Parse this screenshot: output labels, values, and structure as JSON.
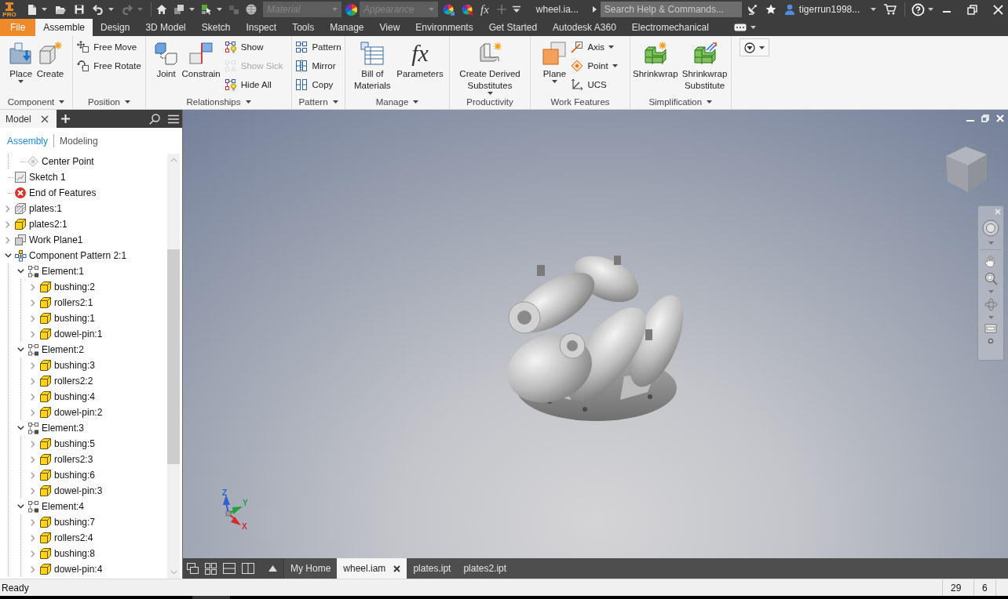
{
  "title_bar": {
    "logo_badge": "PRO",
    "quick_access": [
      {
        "dropdown": true,
        "disabled": false
      },
      {
        "dropdown": false,
        "disabled": false
      },
      {
        "dropdown": false,
        "disabled": false
      },
      {
        "dropdown": true,
        "disabled": false
      },
      {
        "dropdown": true,
        "disabled": true
      }
    ],
    "view_tools": [
      {
        "dropdown": false,
        "disabled": false
      },
      {
        "dropdown": true,
        "disabled": false
      },
      {
        "dropdown": true,
        "disabled": false
      },
      {
        "dropdown": false,
        "disabled": true
      },
      {
        "dropdown": false,
        "disabled": false
      }
    ],
    "material": {
      "placeholder": "Material",
      "disabled": true
    },
    "appearance": {
      "placeholder": "Appearance",
      "disabled": true
    },
    "formula_symbol": "fx",
    "document_name": "wheel.ia...",
    "search": {
      "placeholder": "Search Help & Commands..."
    },
    "user": "tigerrun1998..."
  },
  "ribbon_tabs": [
    {
      "label": "File",
      "kind": "application",
      "selected": false
    },
    {
      "label": "Assemble",
      "kind": "tab",
      "selected": true
    },
    {
      "label": "Design",
      "kind": "tab",
      "selected": false
    },
    {
      "label": "3D Model",
      "kind": "tab",
      "selected": false
    },
    {
      "label": "Sketch",
      "kind": "tab",
      "selected": false
    },
    {
      "label": "Inspect",
      "kind": "tab",
      "selected": false
    },
    {
      "label": "Tools",
      "kind": "tab",
      "selected": false
    },
    {
      "label": "Manage",
      "kind": "tab",
      "selected": false
    },
    {
      "label": "View",
      "kind": "tab",
      "selected": false
    },
    {
      "label": "Environments",
      "kind": "tab",
      "selected": false
    },
    {
      "label": "Get Started",
      "kind": "tab",
      "selected": false
    },
    {
      "label": "Autodesk A360",
      "kind": "tab",
      "selected": false
    },
    {
      "label": "Electromechanical",
      "kind": "tab",
      "selected": false
    }
  ],
  "ribbon_panels": [
    {
      "title": "Component",
      "dropdown": true,
      "items": [
        {
          "kind": "large",
          "label": "Place",
          "dropdown": true,
          "disabled": false
        },
        {
          "kind": "large",
          "label": "Create",
          "dropdown": false,
          "disabled": false
        }
      ]
    },
    {
      "title": "Position",
      "dropdown": true,
      "items": [
        {
          "kind": "small",
          "label": "Free Move",
          "dropdown": false,
          "disabled": false
        },
        {
          "kind": "small",
          "label": "Free Rotate",
          "dropdown": false,
          "disabled": false
        }
      ]
    },
    {
      "title": "Relationships",
      "dropdown": true,
      "items": [
        {
          "kind": "large",
          "label": "Joint",
          "dropdown": false,
          "disabled": false
        },
        {
          "kind": "large",
          "label": "Constrain",
          "dropdown": false,
          "disabled": false
        },
        {
          "kind": "small",
          "label": "Show",
          "dropdown": false,
          "disabled": false
        },
        {
          "kind": "small",
          "label": "Show Sick",
          "dropdown": false,
          "disabled": true
        },
        {
          "kind": "small",
          "label": "Hide All",
          "dropdown": false,
          "disabled": false
        }
      ]
    },
    {
      "title": "Pattern",
      "dropdown": true,
      "items": [
        {
          "kind": "small",
          "label": "Pattern",
          "dropdown": false,
          "disabled": false
        },
        {
          "kind": "small",
          "label": "Mirror",
          "dropdown": false,
          "disabled": false
        },
        {
          "kind": "small",
          "label": "Copy",
          "dropdown": false,
          "disabled": false
        }
      ]
    },
    {
      "title": "Manage",
      "dropdown": true,
      "items": [
        {
          "kind": "large",
          "label": "Bill of Materials",
          "dropdown": false,
          "disabled": false
        },
        {
          "kind": "large",
          "label": "Parameters",
          "symbol": "fx",
          "dropdown": false,
          "disabled": false
        }
      ]
    },
    {
      "title": "Productivity",
      "dropdown": false,
      "items": [
        {
          "kind": "large",
          "label": "Create Derived Substitutes",
          "dropdown": true,
          "disabled": false
        }
      ]
    },
    {
      "title": "Work Features",
      "dropdown": false,
      "items": [
        {
          "kind": "large",
          "label": "Plane",
          "dropdown": true,
          "disabled": false
        },
        {
          "kind": "small",
          "label": "Axis",
          "dropdown": true,
          "disabled": false
        },
        {
          "kind": "small",
          "label": "Point",
          "dropdown": true,
          "disabled": false
        },
        {
          "kind": "small",
          "label": "UCS",
          "dropdown": false,
          "disabled": false
        }
      ]
    },
    {
      "title": "Simplification",
      "dropdown": true,
      "items": [
        {
          "kind": "large",
          "label": "Shrinkwrap",
          "dropdown": false,
          "disabled": false
        },
        {
          "kind": "large",
          "label": "Shrinkwrap Substitute",
          "dropdown": false,
          "disabled": false
        }
      ]
    }
  ],
  "browser": {
    "tab": "Model",
    "views": [
      {
        "label": "Assembly",
        "selected": true
      },
      {
        "label": "Modeling",
        "selected": false
      }
    ],
    "tree": [
      {
        "children": [
          {
            "label": "Center Point",
            "kind": "work-point"
          }
        ]
      },
      {
        "label": "Sketch 1",
        "kind": "sketch"
      },
      {
        "label": "End of Features",
        "kind": "end"
      },
      {
        "label": "plates:1",
        "kind": "hidden-part",
        "expanded": false
      },
      {
        "label": "plates2:1",
        "kind": "part",
        "expanded": false
      },
      {
        "label": "Work Plane1",
        "kind": "work-plane",
        "expanded": false
      },
      {
        "label": "Component Pattern 2:1",
        "kind": "pattern",
        "expanded": true,
        "children": [
          {
            "label": "Element:1",
            "kind": "element",
            "expanded": true,
            "children": [
              {
                "label": "bushing:2",
                "kind": "part",
                "expanded": false
              },
              {
                "label": "rollers2:1",
                "kind": "part",
                "expanded": false
              },
              {
                "label": "bushing:1",
                "kind": "part",
                "expanded": false
              },
              {
                "label": "dowel-pin:1",
                "kind": "part",
                "expanded": false
              }
            ]
          },
          {
            "label": "Element:2",
            "kind": "element",
            "expanded": true,
            "children": [
              {
                "label": "bushing:3",
                "kind": "part",
                "expanded": false
              },
              {
                "label": "rollers2:2",
                "kind": "part",
                "expanded": false
              },
              {
                "label": "bushing:4",
                "kind": "part",
                "expanded": false
              },
              {
                "label": "dowel-pin:2",
                "kind": "part",
                "expanded": false
              }
            ]
          },
          {
            "label": "Element:3",
            "kind": "element",
            "expanded": true,
            "children": [
              {
                "label": "bushing:5",
                "kind": "part",
                "expanded": false
              },
              {
                "label": "rollers2:3",
                "kind": "part",
                "expanded": false
              },
              {
                "label": "bushing:6",
                "kind": "part",
                "expanded": false
              },
              {
                "label": "dowel-pin:3",
                "kind": "part",
                "expanded": false
              }
            ]
          },
          {
            "label": "Element:4",
            "kind": "element",
            "expanded": true,
            "children": [
              {
                "label": "bushing:7",
                "kind": "part",
                "expanded": false
              },
              {
                "label": "rollers2:4",
                "kind": "part",
                "expanded": false
              },
              {
                "label": "bushing:8",
                "kind": "part",
                "expanded": false
              },
              {
                "label": "dowel-pin:4",
                "kind": "part",
                "expanded": false
              }
            ]
          }
        ]
      }
    ]
  },
  "viewport": {
    "triad": [
      {
        "label": "Z",
        "color": "#2f5fd0"
      },
      {
        "label": "Y",
        "color": "#22a03c"
      },
      {
        "label": "X",
        "color": "#d42a2a"
      }
    ]
  },
  "document_tabs": [
    {
      "label": "My Home",
      "selected": false
    },
    {
      "label": "wheel.iam",
      "selected": true
    },
    {
      "label": "plates.ipt",
      "selected": false
    },
    {
      "label": "plates2.ipt",
      "selected": false
    }
  ],
  "status_bar": {
    "message": "Ready",
    "cells": [
      "29",
      "6"
    ]
  }
}
